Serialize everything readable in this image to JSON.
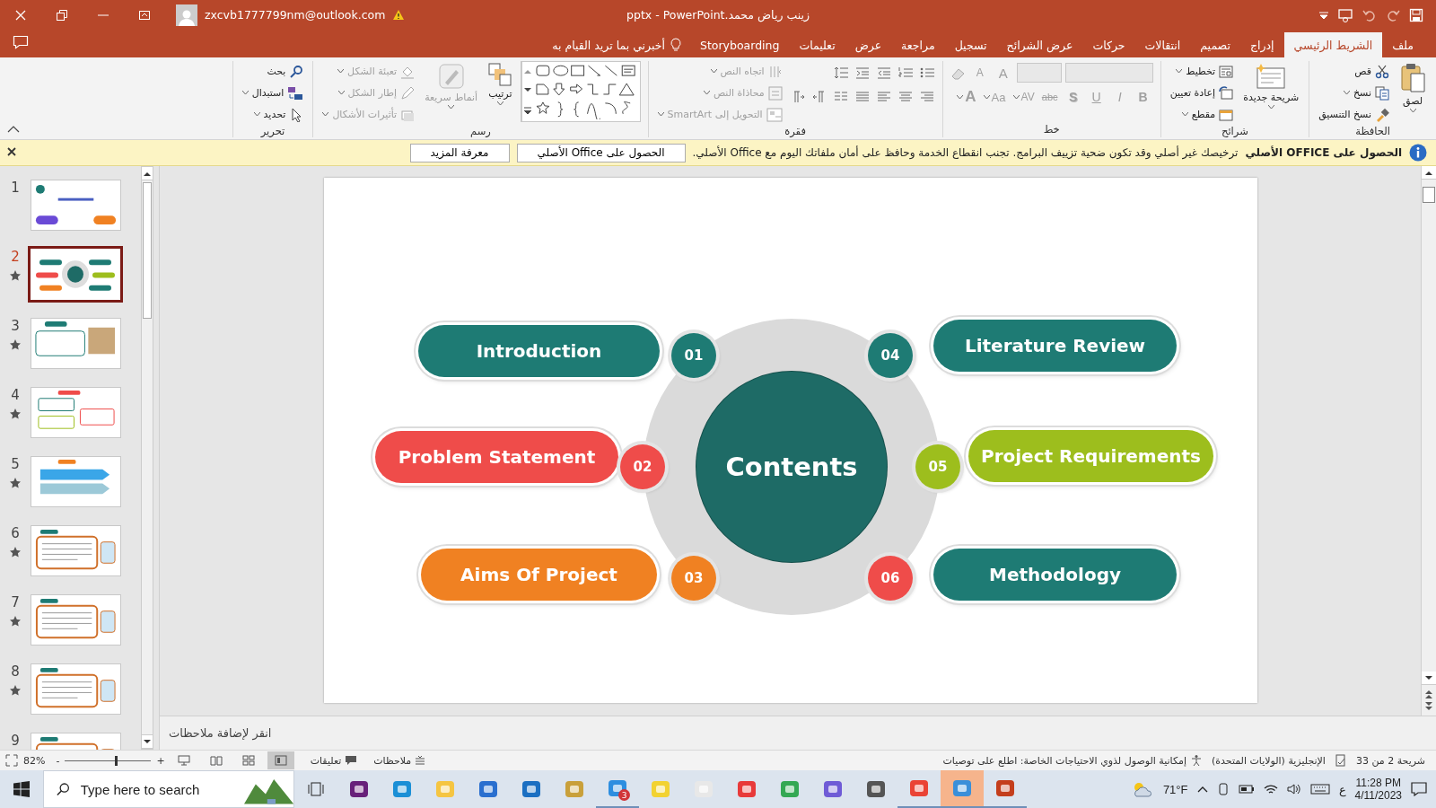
{
  "title_bar": {
    "title": "زينب رياض محمد.pptx  -  PowerPoint",
    "account": "zxcvb1777799nm@outlook.com"
  },
  "tabs": [
    {
      "label": "ملف",
      "selected": false
    },
    {
      "label": "الشريط الرئيسي",
      "selected": true
    },
    {
      "label": "إدراج",
      "selected": false
    },
    {
      "label": "تصميم",
      "selected": false
    },
    {
      "label": "انتقالات",
      "selected": false
    },
    {
      "label": "حركات",
      "selected": false
    },
    {
      "label": "عرض الشرائح",
      "selected": false
    },
    {
      "label": "تسجيل",
      "selected": false
    },
    {
      "label": "مراجعة",
      "selected": false
    },
    {
      "label": "عرض",
      "selected": false
    },
    {
      "label": "تعليمات",
      "selected": false
    },
    {
      "label": "Storyboarding",
      "selected": false
    }
  ],
  "tell_me": "أخبرني بما تريد القيام به",
  "ribbon": {
    "groups": [
      {
        "kind": "stack",
        "label": "الحافظة",
        "items": [
          {
            "kind": "large",
            "label": "لصق",
            "disabled": false,
            "dropdown": true
          },
          {
            "kind": "small",
            "label": "قص",
            "disabled": false,
            "dropdown": false
          },
          {
            "kind": "small",
            "label": "نسخ",
            "disabled": false,
            "dropdown": true
          },
          {
            "kind": "small",
            "label": "نسخ التنسيق",
            "disabled": false,
            "dropdown": false
          }
        ]
      },
      {
        "kind": "stack",
        "label": "شرائح",
        "items": [
          {
            "kind": "large",
            "label": "شريحة جديدة",
            "disabled": false,
            "dropdown": true
          },
          {
            "kind": "small",
            "label": "تخطيط",
            "disabled": false,
            "dropdown": true
          },
          {
            "kind": "small",
            "label": "إعادة تعيين",
            "disabled": false,
            "dropdown": false
          },
          {
            "kind": "small",
            "label": "مقطع",
            "disabled": false,
            "dropdown": true
          }
        ]
      },
      {
        "kind": "font",
        "label": "خط",
        "items": [
          {
            "kind": "glyph",
            "label": "A",
            "disabled": true,
            "dropdown": false
          },
          {
            "kind": "glyph",
            "label": "A",
            "disabled": true,
            "dropdown": false
          },
          {
            "kind": "glyph",
            "label": "B",
            "disabled": true,
            "dropdown": false
          },
          {
            "kind": "glyph",
            "label": "I",
            "disabled": true,
            "dropdown": false
          },
          {
            "kind": "glyph",
            "label": "U",
            "disabled": true,
            "dropdown": false
          },
          {
            "kind": "glyph",
            "label": "S",
            "disabled": true,
            "dropdown": false
          },
          {
            "kind": "glyph",
            "label": "abc",
            "disabled": true,
            "dropdown": false
          },
          {
            "kind": "glyph",
            "label": "AV",
            "disabled": true,
            "dropdown": true
          },
          {
            "kind": "glyph",
            "label": "Aa",
            "disabled": true,
            "dropdown": true
          },
          {
            "kind": "glyph",
            "label": "A",
            "disabled": true,
            "dropdown": true
          }
        ]
      },
      {
        "kind": "paragraph",
        "label": "فقرة",
        "items": [
          {
            "kind": "small",
            "label": "اتجاه النص",
            "disabled": true,
            "dropdown": true
          },
          {
            "kind": "small",
            "label": "محاذاة النص",
            "disabled": true,
            "dropdown": true
          },
          {
            "kind": "small",
            "label": "التحويل إلى SmartArt",
            "disabled": true,
            "dropdown": true
          }
        ]
      },
      {
        "kind": "drawing",
        "label": "رسم",
        "items": [
          {
            "kind": "large",
            "label": "ترتيب",
            "disabled": false,
            "dropdown": true
          },
          {
            "kind": "large",
            "label": "أنماط سريعة",
            "disabled": true,
            "dropdown": true
          },
          {
            "kind": "small",
            "label": "تعبئة الشكل",
            "disabled": true,
            "dropdown": true
          },
          {
            "kind": "small",
            "label": "إطار الشكل",
            "disabled": true,
            "dropdown": true
          },
          {
            "kind": "small",
            "label": "تأثيرات الأشكال",
            "disabled": true,
            "dropdown": true
          }
        ]
      },
      {
        "kind": "stack",
        "label": "تحرير",
        "items": [
          {
            "kind": "small",
            "label": "بحث",
            "disabled": false,
            "dropdown": false
          },
          {
            "kind": "small",
            "label": "استبدال",
            "disabled": false,
            "dropdown": true
          },
          {
            "kind": "small",
            "label": "تحديد",
            "disabled": false,
            "dropdown": true
          }
        ]
      }
    ]
  },
  "info_bar": {
    "title": "الحصول على OFFICE الأصلي",
    "message": "ترخيصك غير أصلي وقد تكون ضحية تزييف البرامج. تجنب انقطاع الخدمة وحافظ على أمان ملفاتك اليوم مع Office الأصلي.",
    "buttons": [
      "الحصول على Office الأصلي",
      "معرفة المزيد"
    ]
  },
  "slides": [
    {
      "number": "1",
      "selected": false,
      "animated": false
    },
    {
      "number": "2",
      "selected": true,
      "animated": true
    },
    {
      "number": "3",
      "selected": false,
      "animated": true
    },
    {
      "number": "4",
      "selected": false,
      "animated": true
    },
    {
      "number": "5",
      "selected": false,
      "animated": true
    },
    {
      "number": "6",
      "selected": false,
      "animated": true
    },
    {
      "number": "7",
      "selected": false,
      "animated": true
    },
    {
      "number": "8",
      "selected": false,
      "animated": true
    },
    {
      "number": "9",
      "selected": false,
      "animated": false
    }
  ],
  "slide": {
    "title": "Contents",
    "items": [
      {
        "label": "Introduction",
        "color": "#1e7b74",
        "badge": {
          "number": "01",
          "color": "#1e7b74"
        }
      },
      {
        "label": "Problem Statement",
        "color": "#ef4c4a",
        "badge": {
          "number": "02",
          "color": "#ef4c4a"
        }
      },
      {
        "label": "Aims Of Project",
        "color": "#f08122",
        "badge": {
          "number": "03",
          "color": "#f08122"
        }
      },
      {
        "label": "Literature Review",
        "color": "#1e7b74",
        "badge": {
          "number": "04",
          "color": "#1e7b74"
        }
      },
      {
        "label": "Project Requirements",
        "color": "#9dbe1d",
        "badge": {
          "number": "05",
          "color": "#9dbe1d"
        }
      },
      {
        "label": "Methodology",
        "color": "#1e7b74",
        "badge": {
          "number": "06",
          "color": "#ef4c4a"
        }
      }
    ]
  },
  "notes": {
    "placeholder": "انقر لإضافة ملاحظات"
  },
  "status_bar": {
    "slide_info": "شريحة 2 من 33",
    "language": "الإنجليزية (الولايات المتحدة)",
    "accessibility": "إمكانية الوصول لذوي الاحتياجات الخاصة: اطلع على توصيات",
    "notes_button": "ملاحظات",
    "comments_button": "تعليقات",
    "views": [
      {
        "selected": false
      },
      {
        "selected": false
      },
      {
        "selected": false
      },
      {
        "selected": true
      }
    ],
    "zoom": {
      "reading": "82%",
      "minus": "-",
      "plus": "+",
      "level": 0.59
    }
  },
  "taskbar": {
    "search": {
      "placeholder": "Type here to search"
    },
    "apps": [
      {
        "running": false,
        "selected": false
      },
      {
        "running": false,
        "selected": false
      },
      {
        "running": false,
        "selected": false
      },
      {
        "running": false,
        "selected": false
      },
      {
        "running": false,
        "selected": false
      },
      {
        "running": false,
        "selected": false
      },
      {
        "running": true,
        "selected": false,
        "badge": "3"
      },
      {
        "running": false,
        "selected": false
      },
      {
        "running": false,
        "selected": false
      },
      {
        "running": false,
        "selected": false
      },
      {
        "running": false,
        "selected": false
      },
      {
        "running": false,
        "selected": false
      },
      {
        "running": false,
        "selected": false
      },
      {
        "running": true,
        "selected": false
      },
      {
        "running": true,
        "selected": true
      },
      {
        "running": true,
        "selected": false
      }
    ],
    "weather": "71°F",
    "keyboard": "ع",
    "time": "11:28 PM",
    "date": "4/11/2023"
  }
}
